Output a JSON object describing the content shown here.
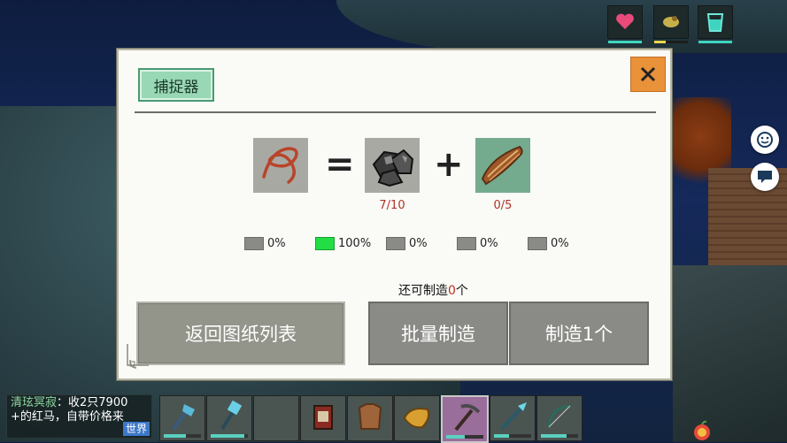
{
  "status_bars": [
    {
      "name": "health",
      "icon": "heart-icon",
      "fill": 1.0,
      "color": "#3fd4c0"
    },
    {
      "name": "hunger",
      "icon": "food-icon",
      "fill": 0.35,
      "color": "#e8d84a"
    },
    {
      "name": "thirst",
      "icon": "cup-icon",
      "fill": 1.0,
      "color": "#3fd4c0"
    }
  ],
  "dialog": {
    "title": "捕捉器",
    "result_icon": "rope-trap-icon",
    "ingredients": [
      {
        "icon": "stone-icon",
        "count": "7/10"
      },
      {
        "icon": "wood-bark-icon",
        "count": "0/5"
      }
    ],
    "probabilities": [
      {
        "value": "0%",
        "full": false
      },
      {
        "value": "100%",
        "full": true
      },
      {
        "value": "0%",
        "full": false
      },
      {
        "value": "0%",
        "full": false
      },
      {
        "value": "0%",
        "full": false
      }
    ],
    "craftable": {
      "prefix": "还可制造",
      "count": "0",
      "suffix": "个"
    },
    "back_button": "返回图纸列表",
    "batch_button": "批量制造",
    "craft_one_button": "制造1个"
  },
  "chat": {
    "sender": "清玹冥寂",
    "message_line1": "：收2只7900",
    "message_line2": "+的红马，自带价格来",
    "channel": "世界"
  },
  "hotbar": [
    {
      "icon": "ice-axe-icon",
      "durability": 0.6
    },
    {
      "icon": "ice-hammer-icon",
      "durability": 0.9
    },
    {
      "icon": "empty-slot",
      "durability": 0
    },
    {
      "icon": "lantern-icon",
      "durability": 0
    },
    {
      "icon": "leather-armor-icon",
      "durability": 0
    },
    {
      "icon": "horn-icon",
      "durability": 0
    },
    {
      "icon": "pickaxe-icon",
      "durability": 0.5,
      "selected": true
    },
    {
      "icon": "ice-spear-icon",
      "durability": 0.4
    },
    {
      "icon": "bow-icon",
      "durability": 0.7
    }
  ],
  "colors": {
    "accent_green": "#98d8b5",
    "close_orange": "#e9923a",
    "count_red": "#b03226"
  }
}
